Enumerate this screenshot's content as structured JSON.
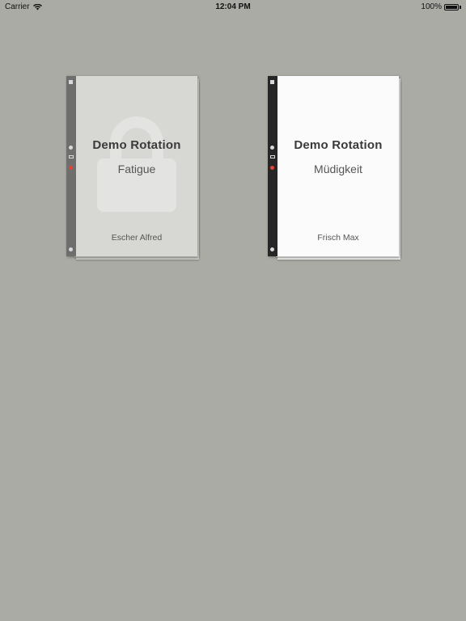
{
  "status_bar": {
    "carrier": "Carrier",
    "time": "12:04 PM",
    "battery": "100%"
  },
  "books": [
    {
      "title": "Demo Rotation",
      "subtitle": "Fatigue",
      "author": "Escher Alfred",
      "locked": true,
      "cover_color": "#d7d8d4",
      "spine_color": "#6e6e6c"
    },
    {
      "title": "Demo Rotation",
      "subtitle": "Müdigkeit",
      "author": "Frisch Max",
      "locked": false,
      "cover_color": "#fbfbfb",
      "spine_color": "#262626"
    }
  ],
  "colors": {
    "background": "#ababa5",
    "accent_red": "#e0443a"
  }
}
